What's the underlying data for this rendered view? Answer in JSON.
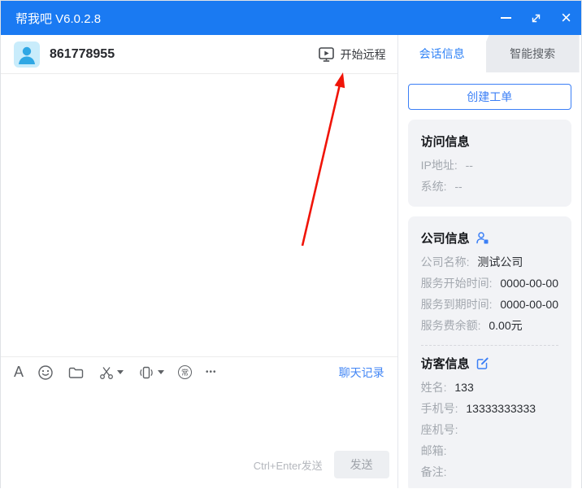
{
  "window": {
    "title": "帮我吧 V6.0.2.8",
    "close_glyph": "×"
  },
  "colors": {
    "titlebar_blue": "#1a7af2",
    "accent_blue": "#3b7ff6",
    "link_blue": "#4286f5",
    "arrow_red": "#f01408",
    "card_bg": "#f2f3f6",
    "label_gray": "#a3a8af",
    "text_dark": "#2b2e33"
  },
  "chat": {
    "header": {
      "user_id": "861778955",
      "remote_label": "开始远程"
    },
    "toolbar": {
      "font_glyph": "A",
      "common_phrases_glyph": "常",
      "more_glyph": "•••",
      "history_label": "聊天记录"
    },
    "footer": {
      "send_hint": "Ctrl+Enter发送",
      "send_label": "发送"
    }
  },
  "sidebar": {
    "tabs": [
      {
        "label": "会话信息",
        "active": true
      },
      {
        "label": "智能搜索",
        "active": false
      }
    ],
    "create_ticket_label": "创建工单",
    "visit_info": {
      "title": "访问信息",
      "rows": [
        {
          "label": "IP地址:",
          "value": "--"
        },
        {
          "label": "系统:",
          "value": "--"
        }
      ]
    },
    "company_info": {
      "title": "公司信息",
      "rows": [
        {
          "label": "公司名称:",
          "value": "测试公司"
        },
        {
          "label": "服务开始时间:",
          "value": "0000-00-00"
        },
        {
          "label": "服务到期时间:",
          "value": "0000-00-00"
        },
        {
          "label": "服务费余额:",
          "value": "0.00元"
        }
      ]
    },
    "visitor_info": {
      "title": "访客信息",
      "rows": [
        {
          "label": "姓名:",
          "value": "133"
        },
        {
          "label": "手机号:",
          "value": "13333333333"
        },
        {
          "label": "座机号:",
          "value": ""
        },
        {
          "label": "邮箱:",
          "value": ""
        },
        {
          "label": "备注:",
          "value": ""
        }
      ]
    }
  }
}
